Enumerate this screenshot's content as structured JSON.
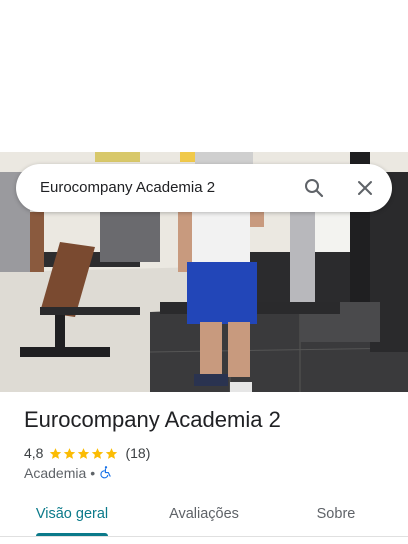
{
  "search": {
    "query": "Eurocompany Academia 2"
  },
  "place": {
    "name": "Eurocompany Academia 2",
    "rating": "4,8",
    "stars": 4.8,
    "review_count": "(18)",
    "category": "Academia",
    "separator": "•"
  },
  "tabs": [
    {
      "label": "Visão geral",
      "active": true
    },
    {
      "label": "Avaliações",
      "active": false
    },
    {
      "label": "Sobre",
      "active": false
    }
  ],
  "colors": {
    "accent": "#0b7a8a",
    "star": "#fbbc04"
  }
}
